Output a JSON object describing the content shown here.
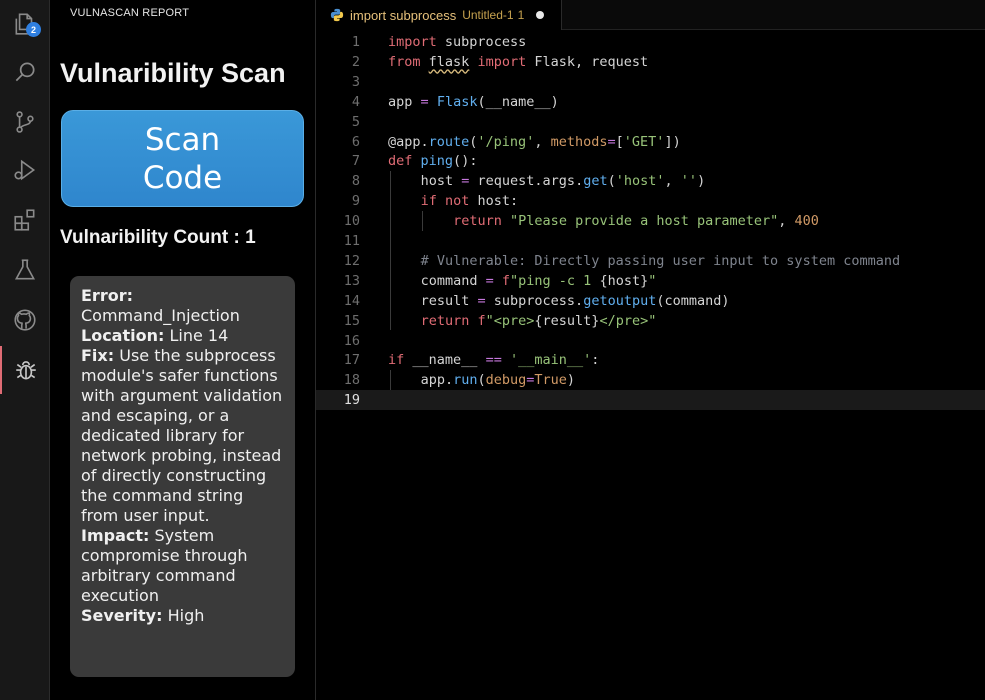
{
  "activity_bar": {
    "explorer_badge": "2",
    "icons": [
      "files-icon",
      "search-icon",
      "source-control-icon",
      "run-debug-icon",
      "extensions-icon",
      "testing-icon",
      "github-icon",
      "bug-icon"
    ]
  },
  "side_panel": {
    "header": "VULNASCAN REPORT",
    "title": "Vulnaribility Scan",
    "scan_button": "Scan Code",
    "count_label": "Vulnaribility Count : 1",
    "card": {
      "error_label": "Error:",
      "error_value": "Command_Injection",
      "location_label": "Location:",
      "location_value": "Line 14",
      "fix_label": "Fix:",
      "fix_value": "Use the subprocess module's safer functions with argument validation and escaping, or a dedicated library for network probing, instead of directly constructing the command string from user input.",
      "impact_label": "Impact:",
      "impact_value": "System compromise through arbitrary command execution",
      "severity_label": "Severity:",
      "severity_value": "High"
    }
  },
  "editor": {
    "tab": {
      "name": "import subprocess",
      "title": "Untitled-1",
      "modified_count": "1"
    },
    "current_line": 19,
    "lines": [
      "import subprocess",
      "from flask import Flask, request",
      "",
      "app = Flask(__name__)",
      "",
      "@app.route('/ping', methods=['GET'])",
      "def ping():",
      "    host = request.args.get('host', '')",
      "    if not host:",
      "        return \"Please provide a host parameter\", 400",
      "",
      "    # Vulnerable: Directly passing user input to system command",
      "    command = f\"ping -c 1 {host}\"",
      "    result = subprocess.getoutput(command)",
      "    return f\"<pre>{result}</pre>\"",
      "",
      "if __name__ == '__main__':",
      "    app.run(debug=True)",
      ""
    ],
    "colors": {
      "keyword": "#e06c75",
      "function": "#61afef",
      "string": "#98c379",
      "operator": "#c678dd",
      "number": "#d19a66",
      "comment": "#7f848e"
    }
  }
}
